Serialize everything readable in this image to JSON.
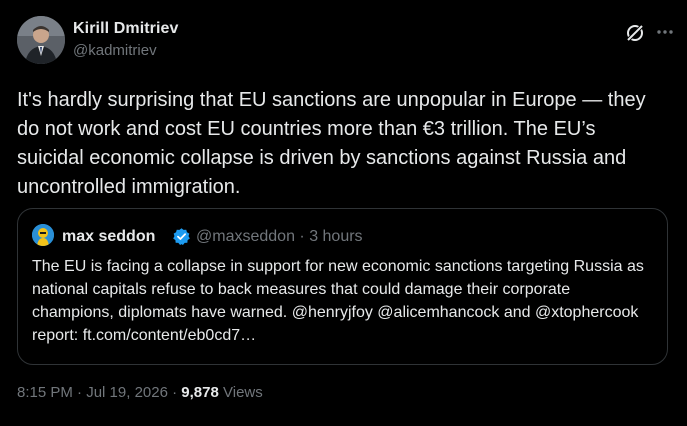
{
  "author": {
    "name": "Kirill Dmitriev",
    "handle": "@kadmitriev"
  },
  "icons": {
    "grok": "grok-icon",
    "more": "more-icon",
    "verified": "verified-badge-icon"
  },
  "tweet": {
    "text": "It's hardly surprising that EU sanctions are unpopular in Europe — they do not work and cost EU countries more than €3 trillion. The EU’s suicidal economic collapse is driven by sanctions against Russia and uncontrolled immigration."
  },
  "quote": {
    "name": "max seddon",
    "handle": "@maxseddon",
    "separator": " · ",
    "time": "3 hours",
    "text": "The EU is facing a collapse in support for new economic sanctions targeting Russia as national capitals refuse to back measures that could damage their corporate champions, diplomats have warned. @henryjfoy @alicemhancock and @xtophercook report: ft.com/content/eb0cd7…"
  },
  "meta": {
    "time": "8:15 PM",
    "separator": " · ",
    "date": "Jul 19, 2026",
    "views_count": "9,878",
    "views_label": "Views"
  },
  "colors": {
    "background": "#000000",
    "text": "#e7e9ea",
    "secondary": "#71767b",
    "border": "#2f3336",
    "verified": "#1d9bf0"
  }
}
